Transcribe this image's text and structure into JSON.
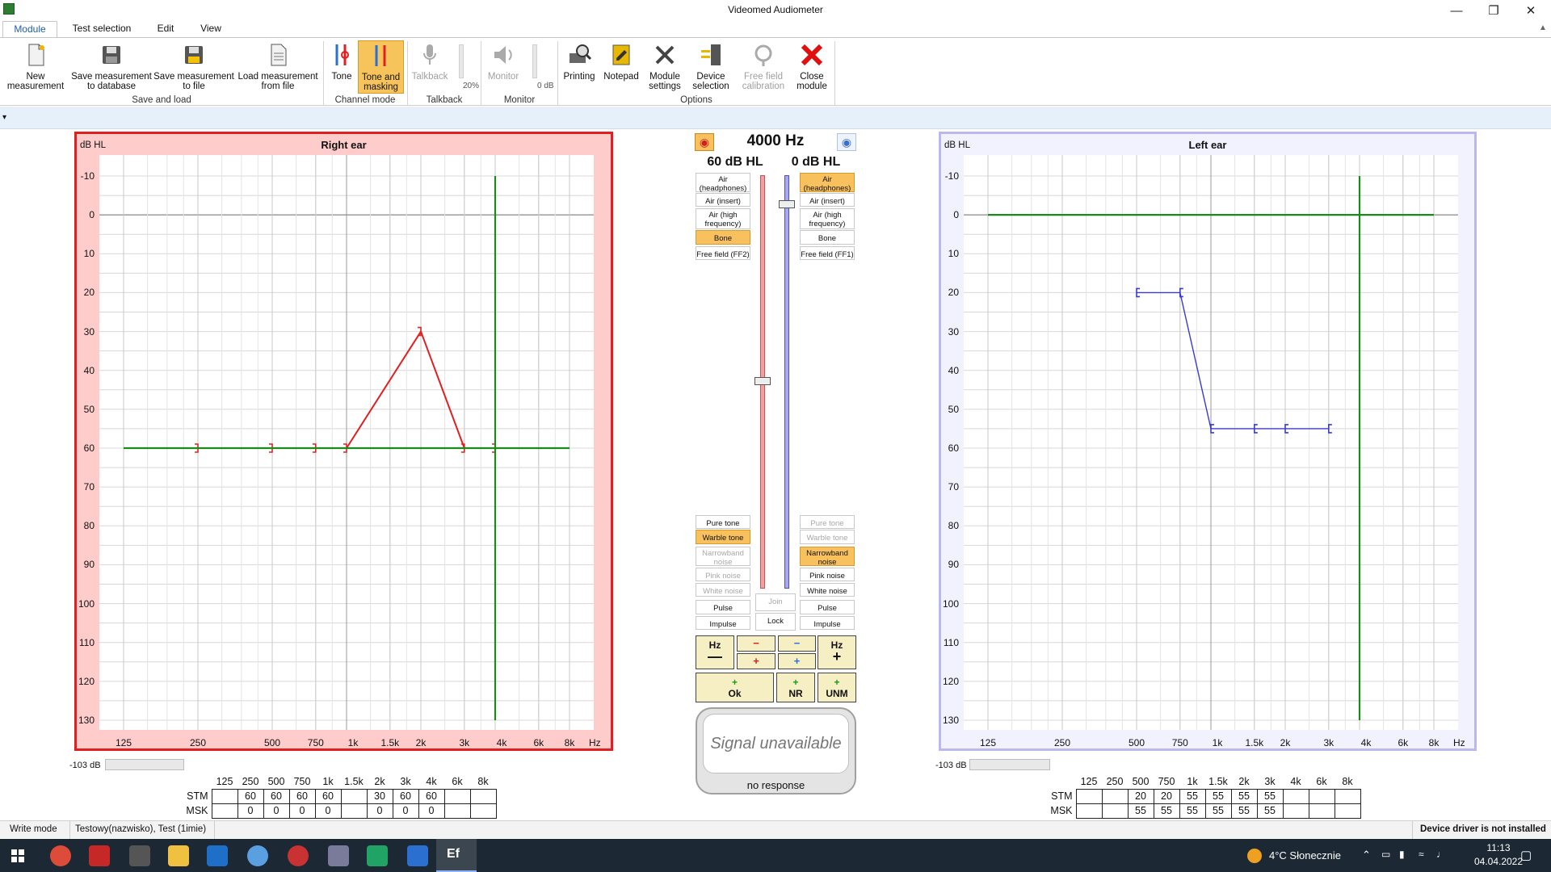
{
  "window": {
    "title": "Videomed Audiometer"
  },
  "ribbon": {
    "tabs": [
      "Module",
      "Test selection",
      "Edit",
      "View"
    ],
    "buttons": {
      "new_measurement": "New\nmeasurement",
      "save_db": "Save measurement\nto database",
      "save_file": "Save measurement\nto file",
      "load_file": "Load measurement\nfrom file",
      "tone": "Tone",
      "tone_masking": "Tone and\nmasking",
      "talkback": "Talkback",
      "talkback_level": "20%",
      "monitor": "Monitor",
      "monitor_level": "0 dB",
      "printing": "Printing",
      "notepad": "Notepad",
      "module_settings": "Module\nsettings",
      "device_selection": "Device\nselection",
      "free_field": "Free field\ncalibration",
      "close_module": "Close\nmodule"
    },
    "groups": {
      "save_load": "Save and load",
      "channel_mode": "Channel mode",
      "talkback": "Talkback",
      "monitor": "Monitor",
      "options": "Options"
    }
  },
  "right_ear": {
    "title": "Right ear",
    "unit": "dB HL",
    "x_unit": "Hz",
    "level": "-103 dB"
  },
  "left_ear": {
    "title": "Left ear",
    "unit": "dB HL",
    "x_unit": "Hz",
    "level": "-103 dB"
  },
  "y_ticks": [
    "-10",
    "0",
    "10",
    "20",
    "30",
    "40",
    "50",
    "60",
    "70",
    "80",
    "90",
    "100",
    "110",
    "120",
    "130"
  ],
  "x_ticks": [
    "125",
    "250",
    "500",
    "750",
    "1k",
    "1.5k",
    "2k",
    "3k",
    "4k",
    "6k",
    "8k"
  ],
  "center": {
    "frequency": "4000 Hz",
    "right_level": "60 dB HL",
    "left_level": "0 dB HL",
    "right_transducers": [
      {
        "label": "Air\n(headphones)",
        "sel": false
      },
      {
        "label": "Air (insert)",
        "sel": false
      },
      {
        "label": "Air (high\nfrequency)",
        "sel": false
      },
      {
        "label": "Bone",
        "sel": true
      },
      {
        "label": "Free field (FF2)",
        "sel": false
      }
    ],
    "left_transducers": [
      {
        "label": "Air\n(headphones)",
        "sel": true
      },
      {
        "label": "Air (insert)",
        "sel": false
      },
      {
        "label": "Air (high\nfrequency)",
        "sel": false
      },
      {
        "label": "Bone",
        "sel": false
      },
      {
        "label": "Free field (FF1)",
        "sel": false
      }
    ],
    "right_signals": [
      {
        "label": "Pure tone",
        "state": "normal"
      },
      {
        "label": "Warble tone",
        "state": "sel"
      },
      {
        "label": "Narrowband\nnoise",
        "state": "dis"
      },
      {
        "label": "Pink noise",
        "state": "dis"
      },
      {
        "label": "White noise",
        "state": "dis"
      },
      {
        "label": "Pulse",
        "state": "normal"
      },
      {
        "label": "Impulse",
        "state": "normal"
      }
    ],
    "left_signals": [
      {
        "label": "Pure tone",
        "state": "dis"
      },
      {
        "label": "Warble tone",
        "state": "dis"
      },
      {
        "label": "Narrowband\nnoise",
        "state": "sel"
      },
      {
        "label": "Pink noise",
        "state": "normal"
      },
      {
        "label": "White noise",
        "state": "normal"
      },
      {
        "label": "Pulse",
        "state": "normal"
      },
      {
        "label": "Impulse",
        "state": "normal"
      }
    ],
    "join": "Join",
    "lock": "Lock",
    "hz": "Hz",
    "ok": "Ok",
    "nr": "NR",
    "unm": "UNM",
    "signal_status": "Signal unavailable",
    "response": "no response"
  },
  "tables": {
    "row_labels": [
      "STM",
      "MSK"
    ],
    "right": {
      "stm": [
        "",
        "60",
        "60",
        "60",
        "60",
        "",
        "30",
        "60",
        "60",
        "",
        ""
      ],
      "msk": [
        "",
        "0",
        "0",
        "0",
        "0",
        "",
        "0",
        "0",
        "0",
        "",
        ""
      ]
    },
    "left": {
      "stm": [
        "",
        "",
        "20",
        "20",
        "55",
        "55",
        "55",
        "55",
        "",
        "",
        ""
      ],
      "msk": [
        "",
        "",
        "55",
        "55",
        "55",
        "55",
        "55",
        "55",
        "",
        "",
        ""
      ]
    }
  },
  "chart_data": [
    {
      "type": "line",
      "title": "Right ear",
      "ylabel": "dB HL",
      "xlabel": "Hz",
      "ylim": [
        -10,
        130
      ],
      "y_inverted": true,
      "x_scale": "log",
      "series": [
        {
          "name": "",
          "x": [
            250,
            500,
            750,
            1000,
            2000,
            3000,
            4000
          ],
          "values": [
            60,
            60,
            60,
            60,
            30,
            60,
            60
          ],
          "color": "#e02020",
          "marker": "bone-bracket-right"
        },
        {
          "name": "",
          "x": [
            125,
            8000
          ],
          "values": [
            60,
            60
          ],
          "color": "#1a8a1a"
        },
        {
          "name": "",
          "x": [
            4000,
            4000
          ],
          "values": [
            -10,
            130
          ],
          "color": "#1a8a1a"
        }
      ]
    },
    {
      "type": "line",
      "title": "Left ear",
      "ylabel": "dB HL",
      "xlabel": "Hz",
      "ylim": [
        -10,
        130
      ],
      "y_inverted": true,
      "x_scale": "log",
      "series": [
        {
          "name": "",
          "x": [
            500,
            750,
            1000,
            1500,
            2000,
            3000
          ],
          "values": [
            20,
            20,
            55,
            55,
            55,
            55
          ],
          "color": "#3a3ad0",
          "marker": "masked-bracket-left"
        },
        {
          "name": "",
          "x": [
            125,
            8000
          ],
          "values": [
            0,
            0
          ],
          "color": "#1a8a1a"
        },
        {
          "name": "",
          "x": [
            4000,
            4000
          ],
          "values": [
            -10,
            130
          ],
          "color": "#1a8a1a"
        }
      ]
    }
  ],
  "status": {
    "mode": "Write mode",
    "patient": "Testowy(nazwisko), Test (1imie)",
    "driver": "Device driver is not installed"
  },
  "taskbar": {
    "weather": "4°C Słonecznie",
    "time": "11:13",
    "date": "04.04.2022"
  },
  "colors": {
    "right": "#e02020",
    "left": "#3a3ad0",
    "green": "#1a8a1a",
    "accent": "#f9c05e"
  }
}
